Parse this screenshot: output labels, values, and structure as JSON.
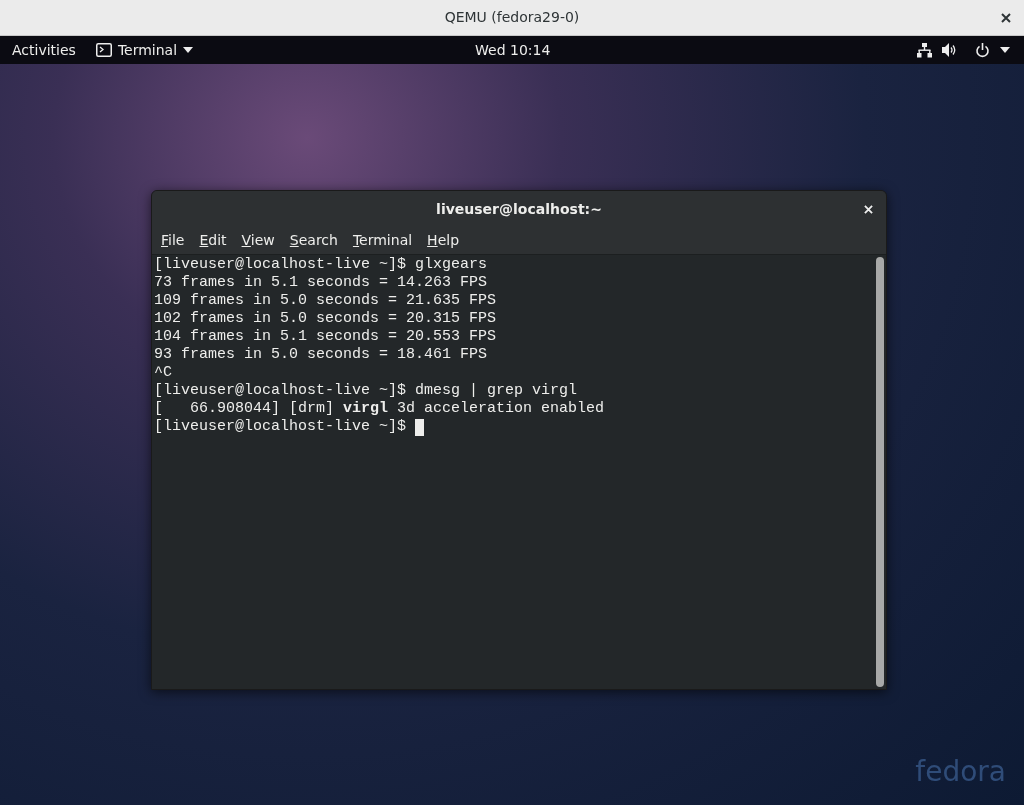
{
  "window": {
    "title": "QEMU (fedora29-0)"
  },
  "top_bar": {
    "activities": "Activities",
    "app_menu": "Terminal",
    "clock": "Wed 10:14"
  },
  "terminal": {
    "title": "liveuser@localhost:~",
    "menu": [
      "File",
      "Edit",
      "View",
      "Search",
      "Terminal",
      "Help"
    ],
    "lines": [
      "[liveuser@localhost-live ~]$ glxgears",
      "73 frames in 5.1 seconds = 14.263 FPS",
      "109 frames in 5.0 seconds = 21.635 FPS",
      "102 frames in 5.0 seconds = 20.315 FPS",
      "104 frames in 5.1 seconds = 20.553 FPS",
      "93 frames in 5.0 seconds = 18.461 FPS",
      "^C",
      "[liveuser@localhost-live ~]$ dmesg | grep virgl",
      "[   66.908044] [drm] **virgl** 3d acceleration enabled",
      "[liveuser@localhost-live ~]$ "
    ]
  },
  "desktop": {
    "logo": "fedora"
  }
}
